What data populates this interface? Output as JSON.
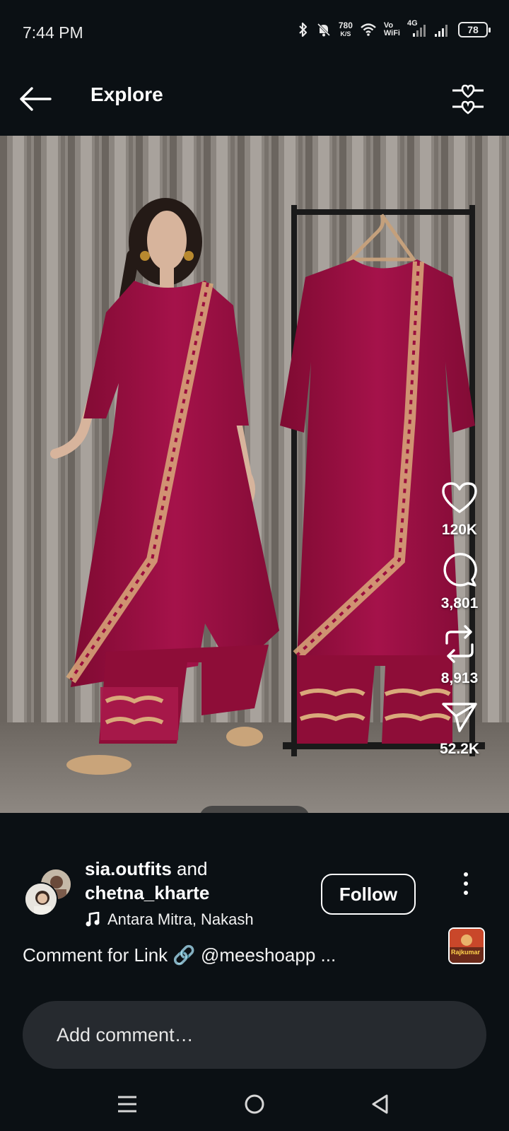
{
  "status_bar": {
    "time": "7:44 PM",
    "net_speed": "780",
    "net_unit": "K/S",
    "vowifi_top": "Vo",
    "vowifi_bottom": "WiFi",
    "network": "4G",
    "battery": "78"
  },
  "header": {
    "title": "Explore",
    "back_icon": "arrow-left-icon",
    "filter_icon": "sliders-heart-icon"
  },
  "media": {
    "page_count": 5,
    "active_page": 1,
    "garment_color": "#9b0f3e"
  },
  "actions": {
    "likes": "120K",
    "comments": "3,801",
    "reposts": "8,913",
    "shares": "52.2K"
  },
  "post": {
    "user1": "sia.outfits",
    "joiner": " and",
    "user2": "chetna_kharte",
    "music": "Antara Mitra, Nakash",
    "follow_label": "Follow",
    "caption": "Comment for Link 🔗 @meeshoapp ...",
    "audio_thumb_text": "Rajkumar"
  },
  "comment": {
    "placeholder": "Add comment…"
  },
  "nav": {
    "recents_icon": "menu-icon",
    "home_icon": "circle-home-icon",
    "back_icon": "triangle-back-icon"
  },
  "colors": {
    "background": "#0b1014",
    "comment_box": "#262a2f",
    "garment": "#9b0f3e"
  }
}
